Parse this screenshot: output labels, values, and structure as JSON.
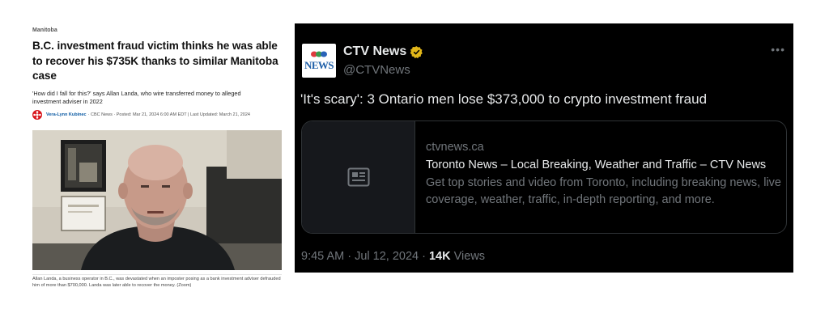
{
  "article": {
    "section": "Manitoba",
    "headline": "B.C. investment fraud victim thinks he was able to recover his $735K thanks to similar Manitoba case",
    "deck": "'How did I fall for this?' says Allan Landa, who wire transferred money to alleged investment adviser in 2022",
    "author": "Vera-Lynn Kubinec",
    "byline_rest": "· CBC News · Posted: Mar 21, 2024 6:00 AM EDT | Last Updated: March 21, 2024",
    "caption": "Allan Landa, a business operator in B.C., was devastated when an imposter posing as a bank investment adviser defrauded him of more than $700,000. Landa was later able to recover the money. (Zoom)"
  },
  "tweet": {
    "avatar_text": "NEWS",
    "display_name": "CTV News",
    "handle": "@CTVNews",
    "more_icon": "more-options-icon",
    "text": "'It's scary': 3 Ontario men lose $373,000 to crypto investment fraud",
    "card": {
      "domain": "ctvnews.ca",
      "title": "Toronto News – Local Breaking, Weather and Traffic – CTV News",
      "description": "Get top stories and video from Toronto, including breaking news, live coverage, weather, traffic, in-depth reporting, and more."
    },
    "time": "9:45 AM · Jul 12, 2024 · ",
    "views_count": "14K",
    "views_label": " Views",
    "verified_color": "#e2b719"
  }
}
